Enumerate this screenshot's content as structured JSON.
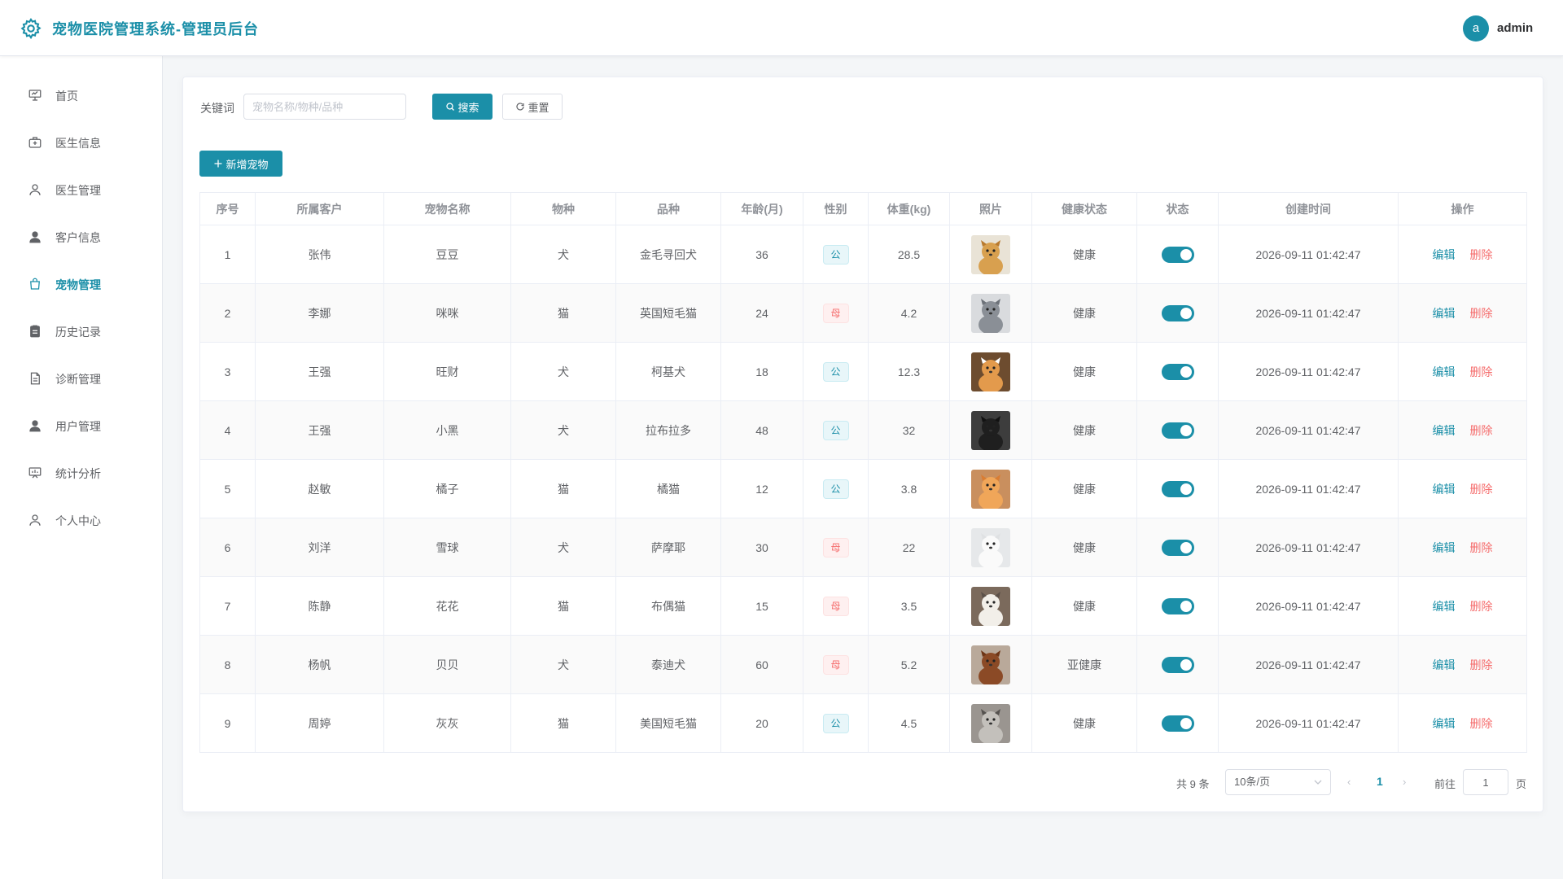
{
  "header": {
    "title": "宠物医院管理系统-管理员后台",
    "avatar_letter": "a",
    "username": "admin"
  },
  "colors": {
    "accent": "#1b8fa8",
    "danger": "#f56c6c",
    "male_tag_bg": "#e8f6f9",
    "female_tag_bg": "#fef0f0"
  },
  "sidebar": {
    "items": [
      {
        "label": "首页",
        "icon": "presentation-board-icon",
        "active": false
      },
      {
        "label": "医生信息",
        "icon": "medical-kit-icon",
        "active": false
      },
      {
        "label": "医生管理",
        "icon": "user-outline-icon",
        "active": false
      },
      {
        "label": "客户信息",
        "icon": "user-filled-icon",
        "active": false
      },
      {
        "label": "宠物管理",
        "icon": "shopping-bag-icon",
        "active": true
      },
      {
        "label": "历史记录",
        "icon": "clipboard-icon",
        "active": false
      },
      {
        "label": "诊断管理",
        "icon": "document-icon",
        "active": false
      },
      {
        "label": "用户管理",
        "icon": "user-filled-icon",
        "active": false
      },
      {
        "label": "统计分析",
        "icon": "chart-board-icon",
        "active": false
      },
      {
        "label": "个人中心",
        "icon": "user-outline-icon",
        "active": false
      }
    ]
  },
  "search": {
    "label": "关键词",
    "placeholder": "宠物名称/物种/品种",
    "value": "",
    "search_label": "搜索",
    "reset_label": "重置"
  },
  "toolbar": {
    "add_label": "新增宠物"
  },
  "table": {
    "columns": [
      "序号",
      "所属客户",
      "宠物名称",
      "物种",
      "品种",
      "年龄(月)",
      "性别",
      "体重(kg)",
      "照片",
      "健康状态",
      "状态",
      "创建时间",
      "操作"
    ],
    "rows": [
      {
        "no": "1",
        "owner": "张伟",
        "name": "豆豆",
        "species": "犬",
        "breed": "金毛寻回犬",
        "age": "36",
        "gender": "公",
        "weight": "28.5",
        "photo": "golden-retriever-photo",
        "health": "健康",
        "status": true,
        "created": "2026-09-11 01:42:47"
      },
      {
        "no": "2",
        "owner": "李娜",
        "name": "咪咪",
        "species": "猫",
        "breed": "英国短毛猫",
        "age": "24",
        "gender": "母",
        "weight": "4.2",
        "photo": "british-shorthair-photo",
        "health": "健康",
        "status": true,
        "created": "2026-09-11 01:42:47"
      },
      {
        "no": "3",
        "owner": "王强",
        "name": "旺财",
        "species": "犬",
        "breed": "柯基犬",
        "age": "18",
        "gender": "公",
        "weight": "12.3",
        "photo": "corgi-photo",
        "health": "健康",
        "status": true,
        "created": "2026-09-11 01:42:47"
      },
      {
        "no": "4",
        "owner": "王强",
        "name": "小黑",
        "species": "犬",
        "breed": "拉布拉多",
        "age": "48",
        "gender": "公",
        "weight": "32",
        "photo": "labrador-photo",
        "health": "健康",
        "status": true,
        "created": "2026-09-11 01:42:47"
      },
      {
        "no": "5",
        "owner": "赵敏",
        "name": "橘子",
        "species": "猫",
        "breed": "橘猫",
        "age": "12",
        "gender": "公",
        "weight": "3.8",
        "photo": "orange-cat-photo",
        "health": "健康",
        "status": true,
        "created": "2026-09-11 01:42:47"
      },
      {
        "no": "6",
        "owner": "刘洋",
        "name": "雪球",
        "species": "犬",
        "breed": "萨摩耶",
        "age": "30",
        "gender": "母",
        "weight": "22",
        "photo": "samoyed-photo",
        "health": "健康",
        "status": true,
        "created": "2026-09-11 01:42:47"
      },
      {
        "no": "7",
        "owner": "陈静",
        "name": "花花",
        "species": "猫",
        "breed": "布偶猫",
        "age": "15",
        "gender": "母",
        "weight": "3.5",
        "photo": "ragdoll-photo",
        "health": "健康",
        "status": true,
        "created": "2026-09-11 01:42:47"
      },
      {
        "no": "8",
        "owner": "杨帆",
        "name": "贝贝",
        "species": "犬",
        "breed": "泰迪犬",
        "age": "60",
        "gender": "母",
        "weight": "5.2",
        "photo": "teddy-poodle-photo",
        "health": "亚健康",
        "status": true,
        "created": "2026-09-11 01:42:47"
      },
      {
        "no": "9",
        "owner": "周婷",
        "name": "灰灰",
        "species": "猫",
        "breed": "美国短毛猫",
        "age": "20",
        "gender": "公",
        "weight": "4.5",
        "photo": "american-shorthair-photo",
        "health": "健康",
        "status": true,
        "created": "2026-09-11 01:42:47"
      }
    ],
    "edit_label": "编辑",
    "delete_label": "删除"
  },
  "pagination": {
    "total_label": "共 9 条",
    "page_size": "10条/页",
    "current_page": "1",
    "goto_label": "前往",
    "goto_value": "1",
    "page_suffix": "页"
  }
}
